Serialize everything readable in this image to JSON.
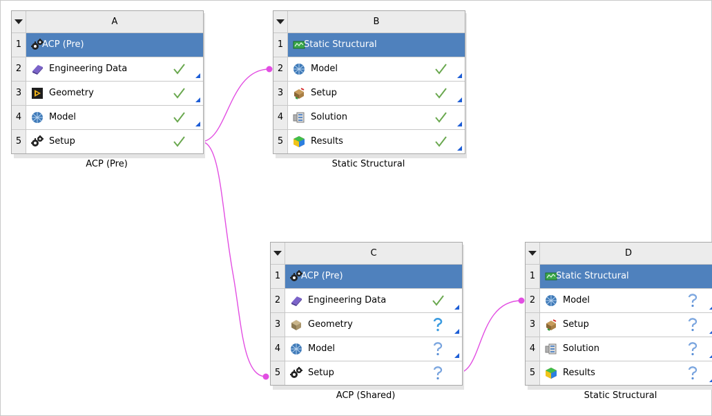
{
  "systems": [
    {
      "letter": "A",
      "caption": "ACP (Pre)",
      "rows": [
        {
          "num": "1",
          "label": "ACP (Pre)",
          "icon": "gears-icon"
        },
        {
          "num": "2",
          "label": "Engineering Data",
          "icon": "engineering-data-book-icon",
          "status": "up-to-date-check"
        },
        {
          "num": "3",
          "label": "Geometry",
          "icon": "geometry-icon",
          "status": "up-to-date-check"
        },
        {
          "num": "4",
          "label": "Model",
          "icon": "model-mesh-icon",
          "status": "up-to-date-check"
        },
        {
          "num": "5",
          "label": "Setup",
          "icon": "gears-icon",
          "status": "up-to-date-check"
        }
      ]
    },
    {
      "letter": "B",
      "caption": "Static Structural",
      "rows": [
        {
          "num": "1",
          "label": "Static Structural",
          "icon": "static-structural-icon"
        },
        {
          "num": "2",
          "label": "Model",
          "icon": "model-mesh-icon",
          "status": "up-to-date-check"
        },
        {
          "num": "3",
          "label": "Setup",
          "icon": "setup-loads-icon",
          "status": "up-to-date-check"
        },
        {
          "num": "4",
          "label": "Solution",
          "icon": "solution-icon",
          "status": "up-to-date-check"
        },
        {
          "num": "5",
          "label": "Results",
          "icon": "results-icon",
          "status": "up-to-date-check"
        }
      ]
    },
    {
      "letter": "C",
      "caption": "ACP (Shared)",
      "rows": [
        {
          "num": "1",
          "label": "ACP (Pre)",
          "icon": "gears-icon"
        },
        {
          "num": "2",
          "label": "Engineering Data",
          "icon": "engineering-data-book-icon",
          "status": "up-to-date-check"
        },
        {
          "num": "3",
          "label": "Geometry",
          "icon": "geometry-box-icon",
          "status": "unfulfilled-question"
        },
        {
          "num": "4",
          "label": "Model",
          "icon": "model-mesh-icon",
          "status": "attention-question"
        },
        {
          "num": "5",
          "label": "Setup",
          "icon": "gears-icon",
          "status": "attention-question"
        }
      ]
    },
    {
      "letter": "D",
      "caption": "Static Structural",
      "rows": [
        {
          "num": "1",
          "label": "Static Structural",
          "icon": "static-structural-icon"
        },
        {
          "num": "2",
          "label": "Model",
          "icon": "model-mesh-icon",
          "status": "attention-question"
        },
        {
          "num": "3",
          "label": "Setup",
          "icon": "setup-loads-icon",
          "status": "attention-question"
        },
        {
          "num": "4",
          "label": "Solution",
          "icon": "solution-icon",
          "status": "attention-question"
        },
        {
          "num": "5",
          "label": "Results",
          "icon": "results-icon",
          "status": "attention-question"
        }
      ]
    }
  ],
  "colors": {
    "title_row": "#4f81bd",
    "connection": "#e24ee2",
    "check": "#6aa84f",
    "corner_marker": "#1e5ed6",
    "question_unfulfilled": "#3a9be0",
    "question_attention": "#5a8fd6"
  },
  "connections": [
    {
      "from": "A.5",
      "to": "B.2",
      "type": "model-share"
    },
    {
      "from": "A.5",
      "to": "C.5",
      "type": "setup-share"
    },
    {
      "from": "C.5",
      "to": "D.2",
      "type": "model-transfer"
    }
  ]
}
